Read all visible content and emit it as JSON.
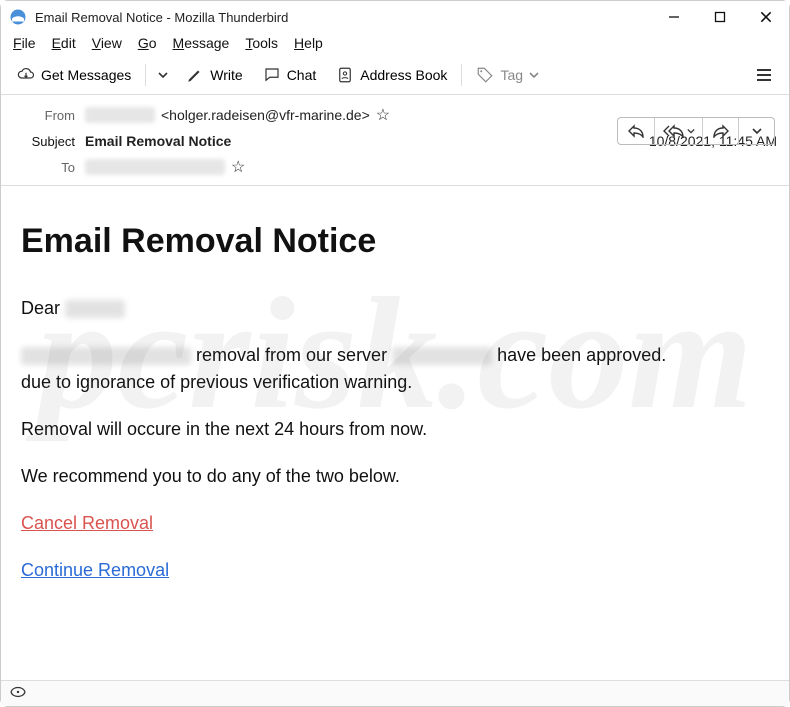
{
  "window": {
    "title": "Email Removal Notice - Mozilla Thunderbird"
  },
  "menu": {
    "file": "File",
    "edit": "Edit",
    "view": "View",
    "go": "Go",
    "message": "Message",
    "tools": "Tools",
    "help": "Help"
  },
  "toolbar": {
    "get_messages": "Get Messages",
    "write": "Write",
    "chat": "Chat",
    "address_book": "Address Book",
    "tag": "Tag"
  },
  "header": {
    "from_label": "From",
    "subject_label": "Subject",
    "to_label": "To",
    "from_email": "<holger.radeisen@vfr-marine.de>",
    "subject": "Email Removal Notice",
    "date": "10/8/2021, 11:45 AM"
  },
  "email_body": {
    "title": "Email Removal Notice",
    "greeting": "Dear",
    "line1_a": "removal from our server",
    "line1_b": "have been approved.",
    "line2": "due to ignorance of previous verification warning.",
    "line3": "Removal will occure in the next 24 hours from now.",
    "line4": "We recommend you to do any of the two below.",
    "link_cancel": "Cancel Removal",
    "link_continue": "Continue Removal"
  }
}
